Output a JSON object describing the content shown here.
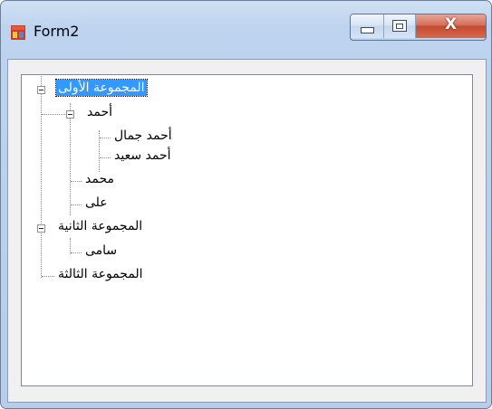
{
  "window": {
    "title": "Form2",
    "close_glyph": "X"
  },
  "icons": {
    "app": "form-app-icon",
    "minimize": "minimize-icon",
    "maximize": "maximize-icon",
    "close": "close-icon",
    "toggle": "collapse-minus-icon"
  },
  "colors": {
    "selection": "#3399ff",
    "close_button": "#c44a30",
    "frame": "#bdd3ee"
  },
  "tree": {
    "nodes": [
      {
        "label": "المجموعة الأولى",
        "expanded": true,
        "selected": true,
        "children": [
          {
            "label": "أحمد",
            "expanded": true,
            "children": [
              {
                "label": "أحمد جمال"
              },
              {
                "label": "أحمد سعيد"
              }
            ]
          },
          {
            "label": "محمد"
          },
          {
            "label": "على"
          }
        ]
      },
      {
        "label": "المجموعة الثانية",
        "expanded": true,
        "children": [
          {
            "label": "سامى"
          }
        ]
      },
      {
        "label": "المجموعة الثالثة"
      }
    ]
  }
}
